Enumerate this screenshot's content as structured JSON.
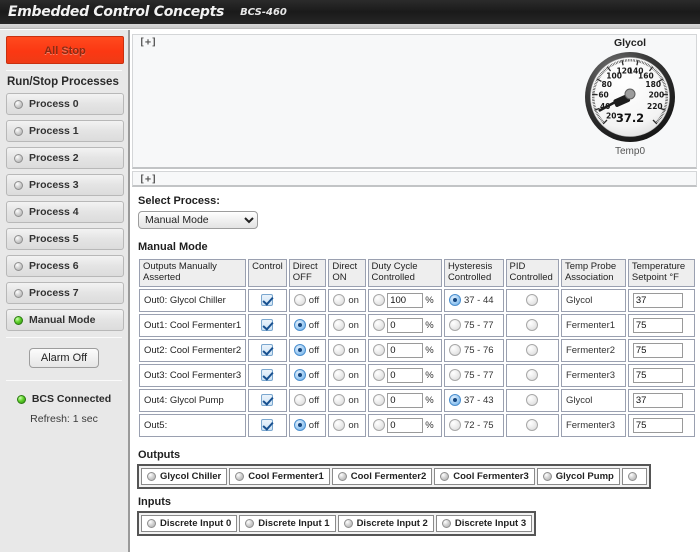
{
  "header": {
    "brand": "Embedded Control Concepts",
    "model": "BCS-460"
  },
  "sidebar": {
    "all_stop_label": "All Stop",
    "runstop_title": "Run/Stop Processes",
    "processes": [
      {
        "label": "Process 0",
        "led": "off"
      },
      {
        "label": "Process 1",
        "led": "off"
      },
      {
        "label": "Process 2",
        "led": "off"
      },
      {
        "label": "Process 3",
        "led": "off"
      },
      {
        "label": "Process 4",
        "led": "off"
      },
      {
        "label": "Process 5",
        "led": "off"
      },
      {
        "label": "Process 6",
        "led": "off"
      },
      {
        "label": "Process 7",
        "led": "off"
      }
    ],
    "manual_mode": {
      "label": "Manual Mode",
      "led": "on"
    },
    "alarm_button": "Alarm Off",
    "connection_status": "BCS Connected",
    "connection_led": "on",
    "refresh": "Refresh: 1 sec"
  },
  "main": {
    "expand_top": "[+]",
    "expand_mid": "[+]",
    "select_process_label": "Select Process:",
    "select_process_value": "Manual Mode",
    "select_process_options": [
      "Manual Mode"
    ],
    "manual_mode_heading": "Manual Mode"
  },
  "gauge": {
    "title": "Glycol",
    "value": "37.2",
    "sub_label": "Temp0",
    "ticks": [
      "20",
      "40",
      "60",
      "80",
      "100",
      "120",
      "140",
      "160",
      "180",
      "200",
      "220"
    ],
    "min": 20,
    "max": 240
  },
  "table": {
    "headers": [
      "Outputs Manually Asserted",
      "Control",
      "Direct OFF",
      "Direct ON",
      "Duty Cycle Controlled",
      "Hysteresis Controlled",
      "PID Controlled",
      "Temp Probe Association",
      "Temperature Setpoint °F"
    ],
    "rows": [
      {
        "name": "Out0:  Glycol Chiller",
        "control_checked": true,
        "direct_off_selected": false,
        "direct_off_label": "off",
        "direct_on_selected": false,
        "direct_on_label": "on",
        "duty_selected": false,
        "duty_value": "100",
        "duty_unit": "%",
        "hyst_selected": true,
        "hyst_label": "37 - 44",
        "pid_selected": false,
        "probe": "Glycol",
        "setpoint": "37"
      },
      {
        "name": "Out1:  Cool Fermenter1",
        "control_checked": true,
        "direct_off_selected": true,
        "direct_off_label": "off",
        "direct_on_selected": false,
        "direct_on_label": "on",
        "duty_selected": false,
        "duty_value": "0",
        "duty_unit": "%",
        "hyst_selected": false,
        "hyst_label": "75 - 77",
        "pid_selected": false,
        "probe": "Fermenter1",
        "setpoint": "75"
      },
      {
        "name": "Out2:  Cool Fermenter2",
        "control_checked": true,
        "direct_off_selected": true,
        "direct_off_label": "off",
        "direct_on_selected": false,
        "direct_on_label": "on",
        "duty_selected": false,
        "duty_value": "0",
        "duty_unit": "%",
        "hyst_selected": false,
        "hyst_label": "75 - 76",
        "pid_selected": false,
        "probe": "Fermenter2",
        "setpoint": "75"
      },
      {
        "name": "Out3:  Cool Fermenter3",
        "control_checked": true,
        "direct_off_selected": true,
        "direct_off_label": "off",
        "direct_on_selected": false,
        "direct_on_label": "on",
        "duty_selected": false,
        "duty_value": "0",
        "duty_unit": "%",
        "hyst_selected": false,
        "hyst_label": "75 - 77",
        "pid_selected": false,
        "probe": "Fermenter3",
        "setpoint": "75"
      },
      {
        "name": "Out4:  Glycol Pump",
        "control_checked": true,
        "direct_off_selected": false,
        "direct_off_label": "off",
        "direct_on_selected": false,
        "direct_on_label": "on",
        "duty_selected": false,
        "duty_value": "0",
        "duty_unit": "%",
        "hyst_selected": true,
        "hyst_label": "37 - 43",
        "pid_selected": false,
        "probe": "Glycol",
        "setpoint": "37"
      },
      {
        "name": "Out5:",
        "control_checked": true,
        "direct_off_selected": true,
        "direct_off_label": "off",
        "direct_on_selected": false,
        "direct_on_label": "on",
        "duty_selected": false,
        "duty_value": "0",
        "duty_unit": "%",
        "hyst_selected": false,
        "hyst_label": "72 - 75",
        "pid_selected": false,
        "probe": "Fermenter3",
        "setpoint": "75"
      }
    ]
  },
  "outputs": {
    "title": "Outputs",
    "items": [
      {
        "label": "Glycol Chiller",
        "led": "off"
      },
      {
        "label": "Cool Fermenter1",
        "led": "off"
      },
      {
        "label": "Cool Fermenter2",
        "led": "off"
      },
      {
        "label": "Cool Fermenter3",
        "led": "off"
      },
      {
        "label": "Glycol Pump",
        "led": "off"
      },
      {
        "label": "",
        "led": "off"
      }
    ]
  },
  "inputs": {
    "title": "Inputs",
    "items": [
      {
        "label": "Discrete Input 0",
        "led": "off"
      },
      {
        "label": "Discrete Input 1",
        "led": "off"
      },
      {
        "label": "Discrete Input 2",
        "led": "off"
      },
      {
        "label": "Discrete Input 3",
        "led": "off"
      }
    ]
  },
  "colors": {
    "all_stop": "#fb3813",
    "led_on": "#5fd22a",
    "accent_blue": "#14467f"
  }
}
